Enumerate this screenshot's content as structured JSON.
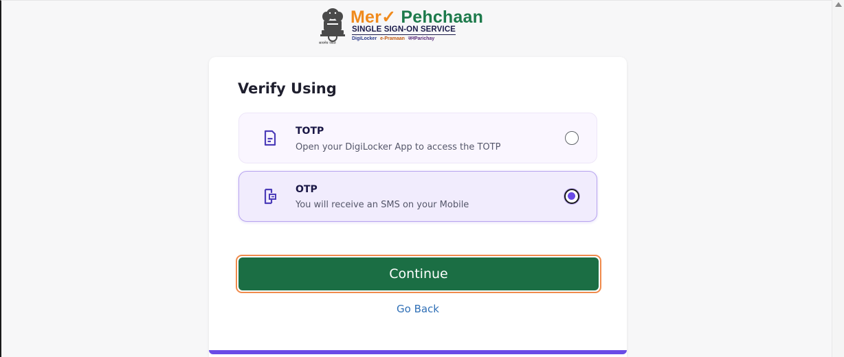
{
  "header": {
    "logo_title_part1": "Mer",
    "logo_title_mark": "✓",
    "logo_title_part2": " Pehchaan",
    "logo_subtitle": "SINGLE SIGN-ON SERVICE",
    "partners": [
      "DigiLocker",
      "e-Pramaan",
      "जनParichay"
    ],
    "emblem_caption": "सत्यमेव जयते",
    "colors": {
      "orange": "#f08a1c",
      "green": "#1d7a4b"
    }
  },
  "card": {
    "title": "Verify Using",
    "options": [
      {
        "label": "TOTP",
        "description": "Open your DigiLocker App to access the TOTP",
        "icon": "document-icon",
        "selected": false
      },
      {
        "label": "OTP",
        "description": "You will receive an SMS on your Mobile",
        "icon": "sms-device-icon",
        "selected": true
      }
    ],
    "continue_label": "Continue",
    "go_back_label": "Go Back",
    "colors": {
      "primary_button": "#1b6e44",
      "button_focus_ring": "#f08a4b",
      "accent": "#6a4be6",
      "link": "#2f6fb6"
    }
  }
}
